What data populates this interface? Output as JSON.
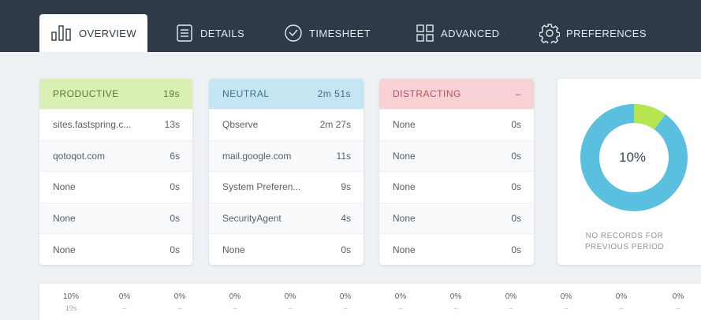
{
  "nav": {
    "tabs": [
      {
        "label": "OVERVIEW",
        "icon": "overview-bars-icon",
        "active": true
      },
      {
        "label": "DETAILS",
        "icon": "document-icon",
        "active": false
      },
      {
        "label": "TIMESHEET",
        "icon": "clock-icon",
        "active": false
      },
      {
        "label": "ADVANCED",
        "icon": "grid-icon",
        "active": false
      },
      {
        "label": "PREFERENCES",
        "icon": "gear-icon",
        "active": false
      }
    ]
  },
  "categories": [
    {
      "name": "PRODUCTIVE",
      "total": "19s",
      "color": "#d9efb3",
      "text_color": "#5a7a2e",
      "rows": [
        {
          "name": "sites.fastspring.c...",
          "time": "13s"
        },
        {
          "name": "qotoqot.com",
          "time": "6s"
        },
        {
          "name": "None",
          "time": "0s"
        },
        {
          "name": "None",
          "time": "0s"
        },
        {
          "name": "None",
          "time": "0s"
        }
      ]
    },
    {
      "name": "NEUTRAL",
      "total": "2m 51s",
      "color": "#c4e6f2",
      "text_color": "#3f6f86",
      "rows": [
        {
          "name": "Qbserve",
          "time": "2m 27s"
        },
        {
          "name": "mail.google.com",
          "time": "11s"
        },
        {
          "name": "System Preferen...",
          "time": "9s"
        },
        {
          "name": "SecurityAgent",
          "time": "4s"
        },
        {
          "name": "None",
          "time": "0s"
        }
      ]
    },
    {
      "name": "DISTRACTING",
      "total": "–",
      "color": "#f8d1d5",
      "text_color": "#b4535e",
      "rows": [
        {
          "name": "None",
          "time": "0s"
        },
        {
          "name": "None",
          "time": "0s"
        },
        {
          "name": "None",
          "time": "0s"
        },
        {
          "name": "None",
          "time": "0s"
        },
        {
          "name": "None",
          "time": "0s"
        }
      ]
    }
  ],
  "donut": {
    "percent_label": "10%",
    "productive_fraction": 0.1,
    "colors": {
      "productive": "#b5e550",
      "neutral": "#5bc0e0"
    },
    "note_line1": "NO RECORDS FOR",
    "note_line2": "PREVIOUS PERIOD"
  },
  "timeline": [
    {
      "pct": "10%",
      "sub": "19s"
    },
    {
      "pct": "0%",
      "sub": "–"
    },
    {
      "pct": "0%",
      "sub": "–"
    },
    {
      "pct": "0%",
      "sub": "–"
    },
    {
      "pct": "0%",
      "sub": "–"
    },
    {
      "pct": "0%",
      "sub": "–"
    },
    {
      "pct": "0%",
      "sub": "–"
    },
    {
      "pct": "0%",
      "sub": "–"
    },
    {
      "pct": "0%",
      "sub": "–"
    },
    {
      "pct": "0%",
      "sub": "–"
    },
    {
      "pct": "0%",
      "sub": "–"
    },
    {
      "pct": "0%",
      "sub": "–"
    }
  ]
}
